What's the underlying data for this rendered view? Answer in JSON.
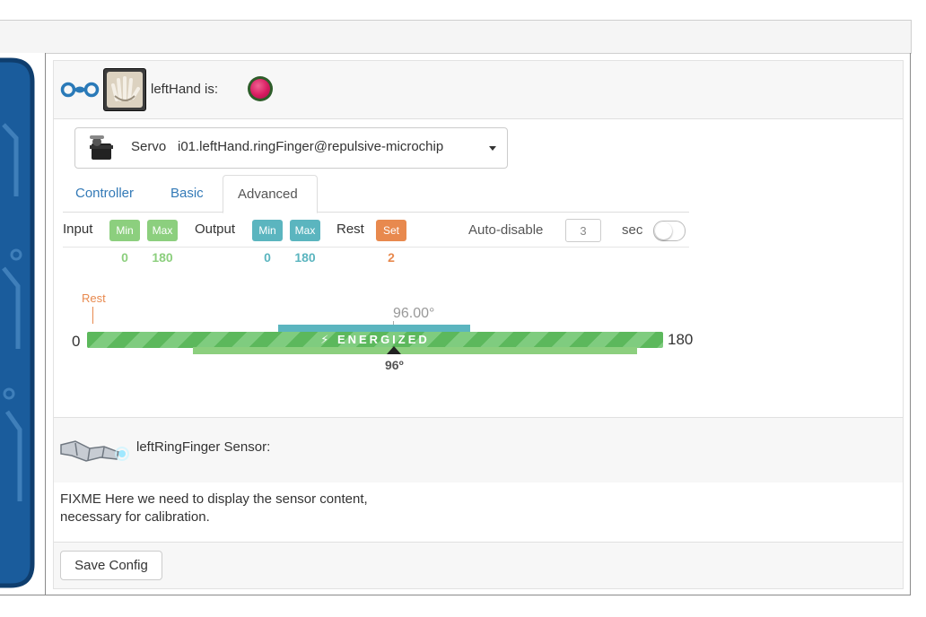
{
  "header": {
    "title": "leftHand is:"
  },
  "servo": {
    "prefix": "Servo",
    "name": "i01.leftHand.ringFinger@repulsive-microchip"
  },
  "tabs": [
    {
      "label": "Controller",
      "active": false
    },
    {
      "label": "Basic",
      "active": false
    },
    {
      "label": "Advanced",
      "active": true
    }
  ],
  "advanced": {
    "input_label": "Input",
    "min_label": "Min",
    "max_label": "Max",
    "output_label": "Output",
    "rest_label": "Rest",
    "set_label": "Set",
    "autodisable_label": "Auto-disable",
    "autodisable_value": "3",
    "sec_label": "sec",
    "input_min": "0",
    "input_max": "180",
    "output_min": "0",
    "output_max": "180",
    "rest_value": "2"
  },
  "slider": {
    "rest_marker_label": "Rest",
    "min_label": "0",
    "max_label": "180",
    "current_label": "96.00°",
    "target_label": "96º",
    "energized_label": "ENERGIZED",
    "position_value": 96
  },
  "sensor": {
    "title": "leftRingFinger Sensor:",
    "note_line1": "FIXME Here we need to display the sensor content,",
    "note_line2": "necessary for calibration."
  },
  "footer": {
    "save_label": "Save Config"
  },
  "colors": {
    "input_green": "#8ccf7e",
    "output_teal": "#5bb5bf",
    "rest_orange": "#e8894e",
    "link_blue": "#337ab7",
    "status_led": "#d81b60"
  }
}
